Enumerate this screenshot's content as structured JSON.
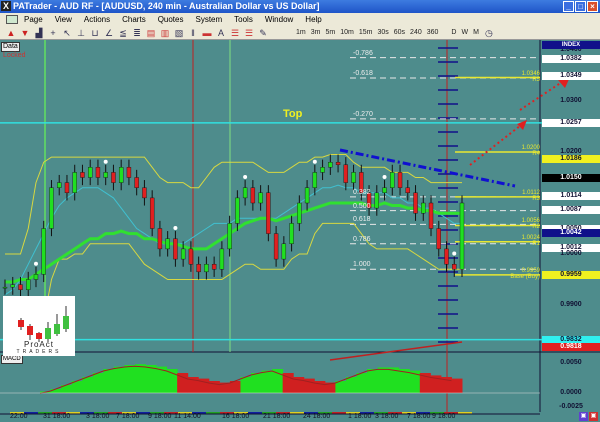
{
  "window": {
    "title": "PATrader - AUD RF - [AUDUSD, 240 min - Australian Dollar vs US Dollar]",
    "app_icon": "X"
  },
  "menu": [
    "Page",
    "View",
    "Actions",
    "Charts",
    "Quotes",
    "System",
    "Tools",
    "Window",
    "Help"
  ],
  "toolbar": {
    "timeframes": [
      "1m",
      "3m",
      "5m",
      "10m",
      "15m",
      "30s",
      "60s",
      "240",
      "360",
      "D",
      "W",
      "M"
    ]
  },
  "panel": {
    "data_label": "Data",
    "locked": "Locked",
    "macd_label": "MACD",
    "top_label": "Top",
    "logo_line1": "ProAct",
    "logo_line2": "TRADERS"
  },
  "axis": {
    "index": "INDEX",
    "labels": [
      {
        "text": "1.0400",
        "price": 1.04,
        "bg": "none"
      },
      {
        "text": "1.0382",
        "price": 1.0382,
        "bg": "#ffffff"
      },
      {
        "text": "1.0349",
        "price": 1.0349,
        "bg": "#ffffff"
      },
      {
        "text": "1.0300",
        "price": 1.03,
        "bg": "none"
      },
      {
        "text": "1.0257",
        "price": 1.0257,
        "bg": "#ffffff"
      },
      {
        "text": "1.0200",
        "price": 1.02,
        "bg": "none"
      },
      {
        "text": "1.0186",
        "price": 1.0186,
        "bg": "#f0f020"
      },
      {
        "text": "1.0150",
        "price": 1.015,
        "bg": "#000000"
      },
      {
        "text": "1.0114",
        "price": 1.0114,
        "bg": "#ffffff"
      },
      {
        "text": "1.0087",
        "price": 1.0087,
        "bg": "#ffffff"
      },
      {
        "text": "1.0050",
        "price": 1.005,
        "bg": "#ffffff"
      },
      {
        "text": "1.0042",
        "price": 1.0042,
        "bg": "#10108a"
      },
      {
        "text": "1.0012",
        "price": 1.0012,
        "bg": "#ffffff"
      },
      {
        "text": "1.0000",
        "price": 1.0,
        "bg": "none"
      },
      {
        "text": "0.9959",
        "price": 0.9959,
        "bg": "#f0f020"
      },
      {
        "text": "0.9900",
        "price": 0.99,
        "bg": "none"
      },
      {
        "text": "0.9832",
        "price": 0.9832,
        "bg": "#30f0f0"
      },
      {
        "text": "0.9818",
        "price": 0.9818,
        "bg": "#e02020"
      }
    ],
    "macd_labels": [
      "0.0050",
      "0.0000",
      "-0.0025"
    ]
  },
  "fib_levels": [
    {
      "text": "-0.786",
      "price": 1.0385
    },
    {
      "text": "-0.618",
      "price": 1.0345
    },
    {
      "text": "-0.270",
      "price": 1.0265
    },
    {
      "text": "0.382",
      "price": 1.0112
    },
    {
      "text": "0.500",
      "price": 1.0085
    },
    {
      "text": "0.618",
      "price": 1.0058
    },
    {
      "text": "0.786",
      "price": 1.002
    },
    {
      "text": "1.000",
      "price": 0.997
    }
  ],
  "resistance_levels": [
    {
      "label": "R5",
      "value": "1.0346",
      "price": 1.0346
    },
    {
      "label": "R4",
      "value": "1.0200",
      "price": 1.02
    },
    {
      "label": "R3",
      "value": "1.0112",
      "price": 1.0112
    },
    {
      "label": "R2",
      "value": "1.0056",
      "price": 1.0056
    },
    {
      "label": "R1",
      "value": "1.0024",
      "price": 1.0024
    },
    {
      "label": "Base (Buy)",
      "value": "0.9959",
      "price": 0.9959
    }
  ],
  "time_labels": [
    "22:00",
    "31 18:00",
    "3 18:00",
    "7 18:00",
    "9 18:00",
    "11 14:00",
    "16 18:00",
    "21 18:00",
    "24 18:00",
    "1 18:00",
    "3 18:00",
    "7 18:00",
    "9 18:00"
  ],
  "colors": {
    "background": "#4e8c8c",
    "bull": "#20e020",
    "bear": "#e02020",
    "band": "#d8d840",
    "ma_fast": "#30e030",
    "ma_slow": "#40c0d0",
    "trend": "#1010d0",
    "cyan_line": "#30e0e0"
  },
  "chart_data": {
    "type": "candlestick",
    "symbol": "AUDUSD",
    "interval": "240 min",
    "closes": [
      0.9935,
      0.994,
      0.993,
      0.995,
      0.996,
      1.005,
      1.013,
      1.014,
      1.012,
      1.016,
      1.015,
      1.017,
      1.015,
      1.016,
      1.014,
      1.017,
      1.015,
      1.013,
      1.011,
      1.005,
      1.001,
      1.003,
      0.999,
      1.001,
      0.998,
      0.9965,
      0.998,
      0.997,
      1.001,
      1.006,
      1.011,
      1.013,
      1.01,
      1.012,
      1.004,
      0.999,
      1.002,
      1.006,
      1.01,
      1.013,
      1.016,
      1.017,
      1.018,
      1.0175,
      1.014,
      1.016,
      1.012,
      1.009,
      1.012,
      1.013,
      1.016,
      1.013,
      1.012,
      1.008,
      1.01,
      1.005,
      1.001,
      0.998,
      0.997,
      1.01
    ],
    "upper_band": [
      1.0,
      1.0,
      1.0,
      1.005,
      1.014,
      1.018,
      1.019,
      1.019,
      1.019,
      1.019,
      1.019,
      1.019,
      1.019,
      1.019,
      1.019,
      1.019,
      1.019,
      1.019,
      1.019,
      1.017,
      1.015,
      1.014,
      1.014,
      1.014,
      1.013,
      1.013,
      1.015,
      1.017,
      1.018,
      1.018,
      1.018,
      1.018,
      1.018,
      1.017,
      1.016,
      1.016,
      1.016,
      1.017,
      1.018,
      1.018,
      1.019,
      1.019,
      1.0195,
      1.0195,
      1.0195,
      1.018,
      1.017,
      1.017,
      1.017,
      1.017,
      1.016,
      1.016,
      1.016,
      1.015,
      1.015,
      1.014,
      1.014,
      1.014,
      1.014,
      1.014
    ],
    "lower_band": [
      0.987,
      0.987,
      0.987,
      0.987,
      0.987,
      0.987,
      0.995,
      0.999,
      0.999,
      1.0,
      1.0,
      1.002,
      1.002,
      1.002,
      1.002,
      1.002,
      1.002,
      1.0,
      0.998,
      0.997,
      0.996,
      0.995,
      0.995,
      0.995,
      0.995,
      0.995,
      0.995,
      0.995,
      0.995,
      0.996,
      0.997,
      0.998,
      0.998,
      0.997,
      0.997,
      0.997,
      0.997,
      0.999,
      1.0,
      1.0,
      1.004,
      1.006,
      1.006,
      1.006,
      1.006,
      1.006,
      1.004,
      1.002,
      1.001,
      1.001,
      1.001,
      1.001,
      1.001,
      1.0,
      0.999,
      0.998,
      0.997,
      0.997,
      0.997,
      0.997
    ],
    "ma_fast": [
      0.9945,
      0.9945,
      0.995,
      0.995,
      0.996,
      0.997,
      0.998,
      0.999,
      1.0,
      1.001,
      1.002,
      1.003,
      1.003,
      1.004,
      1.004,
      1.0045,
      1.004,
      1.004,
      1.003,
      1.003,
      1.0025,
      1.002,
      1.002,
      1.0015,
      1.001,
      1.001,
      1.001,
      1.002,
      1.003,
      1.004,
      1.005,
      1.006,
      1.0065,
      1.007,
      1.007,
      1.0065,
      1.007,
      1.0075,
      1.008,
      1.0085,
      1.009,
      1.0095,
      1.01,
      1.01,
      1.01,
      1.01,
      1.01,
      1.0095,
      1.0095,
      1.01,
      1.0095,
      1.0095,
      1.009,
      1.009,
      1.0085,
      1.0085,
      1.008,
      1.008,
      1.008,
      1.008
    ],
    "ma_slow": [
      0.992,
      0.993,
      0.995,
      0.998,
      1.001,
      1.004,
      1.007,
      1.0095,
      1.011,
      1.012,
      1.013,
      1.013,
      1.013,
      1.012,
      1.011,
      1.009,
      1.007,
      1.005,
      1.004,
      1.003,
      1.002,
      1.002,
      1.002,
      1.002,
      1.003,
      1.004,
      1.005,
      1.006,
      1.006,
      1.006,
      1.007,
      1.007,
      1.007,
      1.007,
      1.007,
      1.007,
      1.008,
      1.009,
      1.01,
      1.011,
      1.012,
      1.013,
      1.013,
      1.0135,
      1.013,
      1.013,
      1.012,
      1.012,
      1.012,
      1.012,
      1.011,
      1.011,
      1.01,
      1.01,
      1.009,
      1.009,
      1.008,
      1.007,
      1.006,
      1.006
    ],
    "macd_hist": [
      0.0002,
      0.0005,
      0.001,
      0.0015,
      0.002,
      0.0025,
      0.003,
      0.0033,
      0.0035,
      0.0036,
      0.0035,
      0.0033,
      0.003,
      0.0025,
      0.002,
      0.0018,
      0.0015,
      0.0013,
      0.0015,
      0.002,
      0.0025,
      0.0028,
      0.003,
      0.0025,
      0.002,
      0.0018,
      0.0015,
      0.0013,
      0.0015,
      0.002,
      0.0025,
      0.003,
      0.0032,
      0.0032,
      0.003,
      0.0028,
      0.0025,
      0.0022,
      0.002,
      0.0018
    ],
    "macd_colors": [
      "g",
      "g",
      "g",
      "g",
      "g",
      "g",
      "g",
      "g",
      "g",
      "g",
      "g",
      "g",
      "g",
      "r",
      "r",
      "r",
      "r",
      "r",
      "r",
      "g",
      "g",
      "g",
      "g",
      "r",
      "r",
      "r",
      "r",
      "r",
      "g",
      "g",
      "g",
      "g",
      "g",
      "g",
      "g",
      "g",
      "r",
      "r",
      "r",
      "r"
    ],
    "ylim": [
      0.978,
      1.041
    ]
  }
}
